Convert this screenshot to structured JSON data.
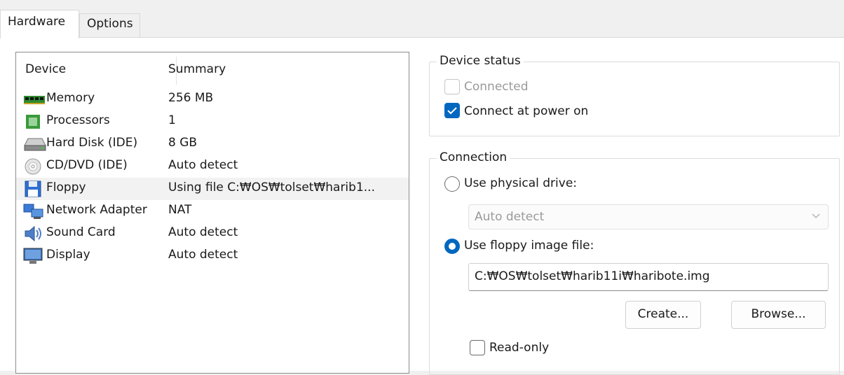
{
  "tabs": [
    {
      "label": "Hardware"
    },
    {
      "label": "Options"
    }
  ],
  "device_list": {
    "headers": {
      "device": "Device",
      "summary": "Summary"
    },
    "rows": [
      {
        "device": "Memory",
        "summary": "256 MB",
        "icon": "memory-icon"
      },
      {
        "device": "Processors",
        "summary": "1",
        "icon": "processor-icon"
      },
      {
        "device": "Hard Disk (IDE)",
        "summary": "8 GB",
        "icon": "hard-disk-icon"
      },
      {
        "device": "CD/DVD (IDE)",
        "summary": "Auto detect",
        "icon": "cd-dvd-icon"
      },
      {
        "device": "Floppy",
        "summary": "Using file C:₩OS₩tolset₩harib1...",
        "icon": "floppy-icon",
        "selected": true
      },
      {
        "device": "Network Adapter",
        "summary": "NAT",
        "icon": "network-adapter-icon"
      },
      {
        "device": "Sound Card",
        "summary": "Auto detect",
        "icon": "sound-card-icon"
      },
      {
        "device": "Display",
        "summary": "Auto detect",
        "icon": "display-icon"
      }
    ]
  },
  "device_status": {
    "title": "Device status",
    "connected": {
      "label": "Connected",
      "checked": false,
      "enabled": false
    },
    "connect_at_power_on": {
      "label": "Connect at power on",
      "checked": true
    }
  },
  "connection": {
    "title": "Connection",
    "use_physical_drive": {
      "label": "Use physical drive:",
      "selected": false
    },
    "drive_select": {
      "value": "Auto detect",
      "enabled": false
    },
    "use_floppy_image": {
      "label": "Use floppy image file:",
      "selected": true
    },
    "image_path": "C:₩OS₩tolset₩harib11i₩haribote.img",
    "create_button": "Create...",
    "browse_button": "Browse...",
    "read_only": {
      "label": "Read-only",
      "checked": false
    }
  },
  "colors": {
    "accent": "#0067c0",
    "selected_row": "#f2f2f2"
  }
}
